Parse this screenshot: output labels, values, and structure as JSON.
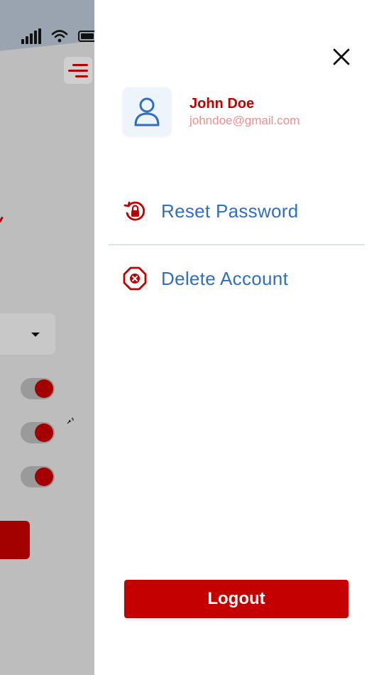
{
  "colors": {
    "brand_red": "#c40000",
    "link_blue": "#2f6fc0",
    "email_pink": "#ec8f8f",
    "overlay_gray": "#bdbdbd"
  },
  "background_app": {
    "status_icons": [
      "signal-icon",
      "wifi-icon",
      "battery-icon"
    ],
    "menu_icon": "menu-icon",
    "toggles": [
      {
        "state": "on"
      },
      {
        "state": "on"
      },
      {
        "state": "on"
      }
    ]
  },
  "drawer": {
    "close_icon": "close-icon",
    "profile": {
      "avatar_icon": "user-icon",
      "name": "John Doe",
      "email": "johndoe@gmail.com"
    },
    "menu": [
      {
        "icon": "lock-reset-icon",
        "label": "Reset Password"
      },
      {
        "icon": "delete-octagon-icon",
        "label": "Delete Account"
      }
    ],
    "logout_label": "Logout"
  }
}
